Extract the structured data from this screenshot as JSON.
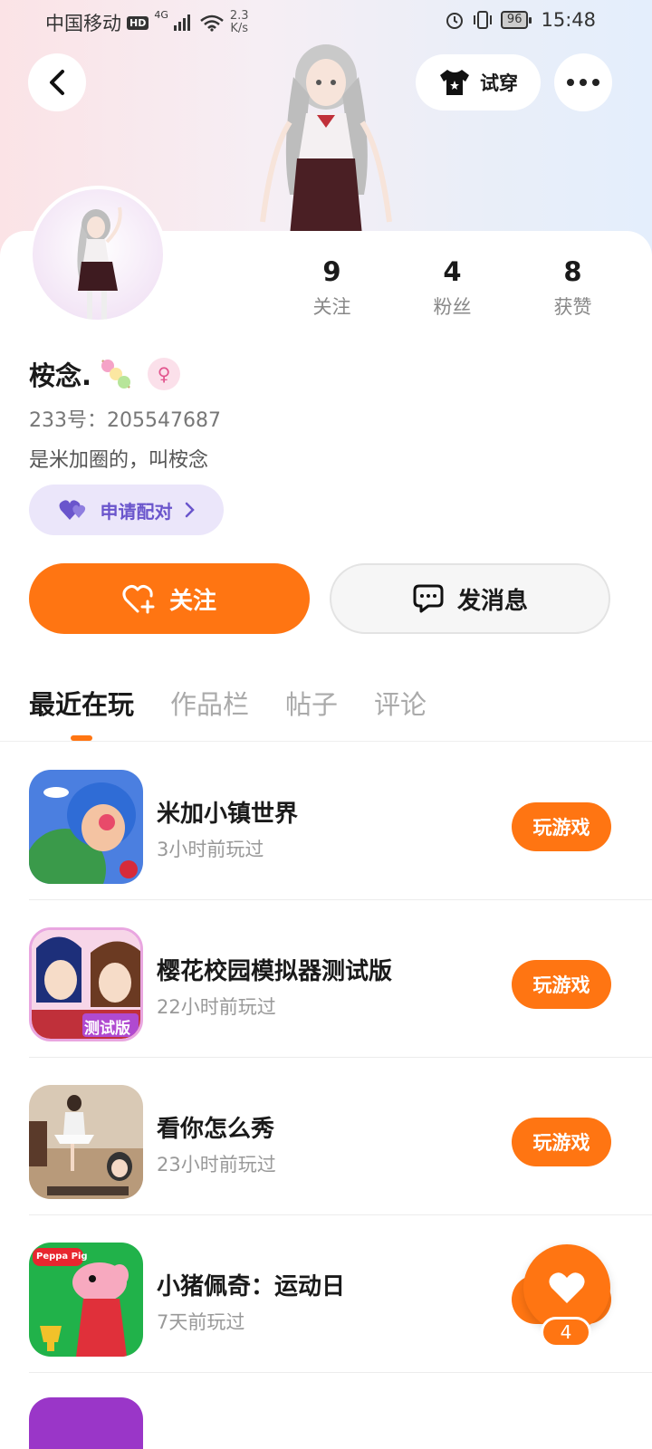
{
  "status_bar": {
    "carrier": "中国移动",
    "hd": "HD",
    "network": "4G",
    "speed_value": "2.3",
    "speed_unit": "K/s",
    "battery": "96",
    "time": "15:48"
  },
  "header": {
    "try_on_label": "试穿"
  },
  "profile": {
    "stats": [
      {
        "value": "9",
        "label": "关注"
      },
      {
        "value": "4",
        "label": "粉丝"
      },
      {
        "value": "8",
        "label": "获赞"
      }
    ],
    "name": "桉念.",
    "gender_symbol": "♀",
    "uid": "233号：205547687",
    "bio": "是米加圈的，叫桉念",
    "pair_label": "申请配对"
  },
  "actions": {
    "follow_label": "关注",
    "message_label": "发消息"
  },
  "tabs": [
    {
      "label": "最近在玩",
      "active": true
    },
    {
      "label": "作品栏",
      "active": false
    },
    {
      "label": "帖子",
      "active": false
    },
    {
      "label": "评论",
      "active": false
    }
  ],
  "games": [
    {
      "name": "米加小镇世界",
      "played": "3小时前玩过",
      "button": "玩游戏"
    },
    {
      "name": "樱花校园模拟器测试版",
      "played": "22小时前玩过",
      "button": "玩游戏"
    },
    {
      "name": "看你怎么秀",
      "played": "23小时前玩过",
      "button": "玩游戏"
    },
    {
      "name": "小猪佩奇：运动日",
      "played": "7天前玩过",
      "button": "玩游戏"
    }
  ],
  "game_icon_text": {
    "sakura_badge": "测试版",
    "peppa_logo": "Peppa Pig"
  },
  "float_like_count": "4",
  "colors": {
    "accent": "#ff7512",
    "pair_bg": "#ebe6fa",
    "pair_text": "#6a55cc"
  }
}
